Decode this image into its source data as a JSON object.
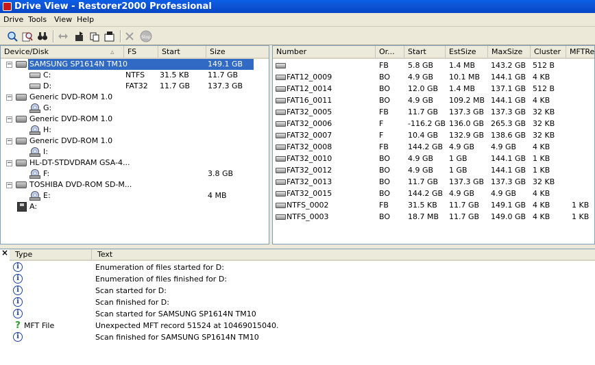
{
  "window": {
    "title": "Drive View - Restorer2000 Professional"
  },
  "menu": [
    "Drive",
    "Tools",
    "View",
    "Help"
  ],
  "toolbar": {
    "stop_label": "Stop"
  },
  "device_tree": {
    "columns": [
      "Device/Disk",
      "FS",
      "Start",
      "Size"
    ],
    "rows": [
      {
        "name": "SAMSUNG SP1614N TM10",
        "fs": "",
        "start": "",
        "size": "149.1 GB",
        "kind": "hdd",
        "level": 0,
        "selected": true
      },
      {
        "name": "C:",
        "fs": "NTFS",
        "start": "31.5 KB",
        "size": "11.7 GB",
        "kind": "partition",
        "level": 1
      },
      {
        "name": "D:",
        "fs": "FAT32",
        "start": "11.7 GB",
        "size": "137.3 GB",
        "kind": "partition",
        "level": 1
      },
      {
        "name": "Generic DVD-ROM 1.0",
        "fs": "",
        "start": "",
        "size": "",
        "kind": "cdrom",
        "level": 0
      },
      {
        "name": "G:",
        "fs": "",
        "start": "",
        "size": "",
        "kind": "cdpart",
        "level": 1
      },
      {
        "name": "Generic DVD-ROM 1.0",
        "fs": "",
        "start": "",
        "size": "",
        "kind": "cdrom",
        "level": 0
      },
      {
        "name": "H:",
        "fs": "",
        "start": "",
        "size": "",
        "kind": "cdpart",
        "level": 1
      },
      {
        "name": "Generic DVD-ROM 1.0",
        "fs": "",
        "start": "",
        "size": "",
        "kind": "cdrom",
        "level": 0
      },
      {
        "name": "I:",
        "fs": "",
        "start": "",
        "size": "",
        "kind": "cdpart",
        "level": 1
      },
      {
        "name": "HL-DT-STDVDRAM GSA-4...",
        "fs": "",
        "start": "",
        "size": "",
        "kind": "cdrom",
        "level": 0
      },
      {
        "name": "F:",
        "fs": "",
        "start": "",
        "size": "3.8 GB",
        "kind": "cdpart",
        "level": 1
      },
      {
        "name": "TOSHIBA DVD-ROM SD-M...",
        "fs": "",
        "start": "",
        "size": "",
        "kind": "cdrom",
        "level": 0
      },
      {
        "name": "E:",
        "fs": "",
        "start": "",
        "size": "4 MB",
        "kind": "cdpart",
        "level": 1
      },
      {
        "name": "A:",
        "fs": "",
        "start": "",
        "size": "",
        "kind": "floppy",
        "level": 0
      }
    ]
  },
  "partitions": {
    "columns": [
      "Number",
      "Or...",
      "Start",
      "EstSize",
      "MaxSize",
      "Cluster",
      "MFTRe"
    ],
    "rows": [
      {
        "number": "",
        "or": "FB",
        "start": "5.8 GB",
        "estsize": "1.4 MB",
        "maxsize": "143.2 GB",
        "cluster": "512 B",
        "mft": ""
      },
      {
        "number": "FAT12_0009",
        "or": "BO",
        "start": "4.9 GB",
        "estsize": "10.1 MB",
        "maxsize": "144.1 GB",
        "cluster": "4 KB",
        "mft": ""
      },
      {
        "number": "FAT12_0014",
        "or": "BO",
        "start": "12.0 GB",
        "estsize": "1.4 MB",
        "maxsize": "137.1 GB",
        "cluster": "512 B",
        "mft": ""
      },
      {
        "number": "FAT16_0011",
        "or": "BO",
        "start": "4.9 GB",
        "estsize": "109.2 MB",
        "maxsize": "144.1 GB",
        "cluster": "4 KB",
        "mft": ""
      },
      {
        "number": "FAT32_0005",
        "or": "FB",
        "start": "11.7 GB",
        "estsize": "137.3 GB",
        "maxsize": "137.3 GB",
        "cluster": "32 KB",
        "mft": ""
      },
      {
        "number": "FAT32_0006",
        "or": "F",
        "start": "-116.2 GB",
        "estsize": "136.0 GB",
        "maxsize": "265.3 GB",
        "cluster": "32 KB",
        "mft": ""
      },
      {
        "number": "FAT32_0007",
        "or": "F",
        "start": "10.4 GB",
        "estsize": "132.9 GB",
        "maxsize": "138.6 GB",
        "cluster": "32 KB",
        "mft": ""
      },
      {
        "number": "FAT32_0008",
        "or": "FB",
        "start": "144.2 GB",
        "estsize": "4.9 GB",
        "maxsize": "4.9 GB",
        "cluster": "4 KB",
        "mft": ""
      },
      {
        "number": "FAT32_0010",
        "or": "BO",
        "start": "4.9 GB",
        "estsize": "1 GB",
        "maxsize": "144.1 GB",
        "cluster": "1 KB",
        "mft": ""
      },
      {
        "number": "FAT32_0012",
        "or": "BO",
        "start": "4.9 GB",
        "estsize": "1 GB",
        "maxsize": "144.1 GB",
        "cluster": "1 KB",
        "mft": ""
      },
      {
        "number": "FAT32_0013",
        "or": "BO",
        "start": "11.7 GB",
        "estsize": "137.3 GB",
        "maxsize": "137.3 GB",
        "cluster": "32 KB",
        "mft": ""
      },
      {
        "number": "FAT32_0015",
        "or": "BO",
        "start": "144.2 GB",
        "estsize": "4.9 GB",
        "maxsize": "4.9 GB",
        "cluster": "4 KB",
        "mft": ""
      },
      {
        "number": "NTFS_0002",
        "or": "FB",
        "start": "31.5 KB",
        "estsize": "11.7 GB",
        "maxsize": "149.1 GB",
        "cluster": "4 KB",
        "mft": "1 KB"
      },
      {
        "number": "NTFS_0003",
        "or": "BO",
        "start": "18.7 MB",
        "estsize": "11.7 GB",
        "maxsize": "149.0 GB",
        "cluster": "4 KB",
        "mft": "1 KB"
      }
    ]
  },
  "log": {
    "close_label": "×",
    "columns": [
      "Type",
      "Text"
    ],
    "rows": [
      {
        "icon": "info-icon",
        "type": "",
        "text": "Enumeration of files started for D:"
      },
      {
        "icon": "info-icon",
        "type": "",
        "text": "Enumeration of files finished for D:"
      },
      {
        "icon": "info-icon",
        "type": "",
        "text": "Scan started for D:"
      },
      {
        "icon": "info-icon",
        "type": "",
        "text": "Scan finished for D:"
      },
      {
        "icon": "info-icon",
        "type": "",
        "text": "Scan started for SAMSUNG SP1614N TM10"
      },
      {
        "icon": "question-icon",
        "type": "MFT File",
        "text": "Unexpected MFT record 51524 at 10469015040."
      },
      {
        "icon": "info-icon",
        "type": "",
        "text": "Scan finished for SAMSUNG SP1614N TM10"
      }
    ]
  }
}
